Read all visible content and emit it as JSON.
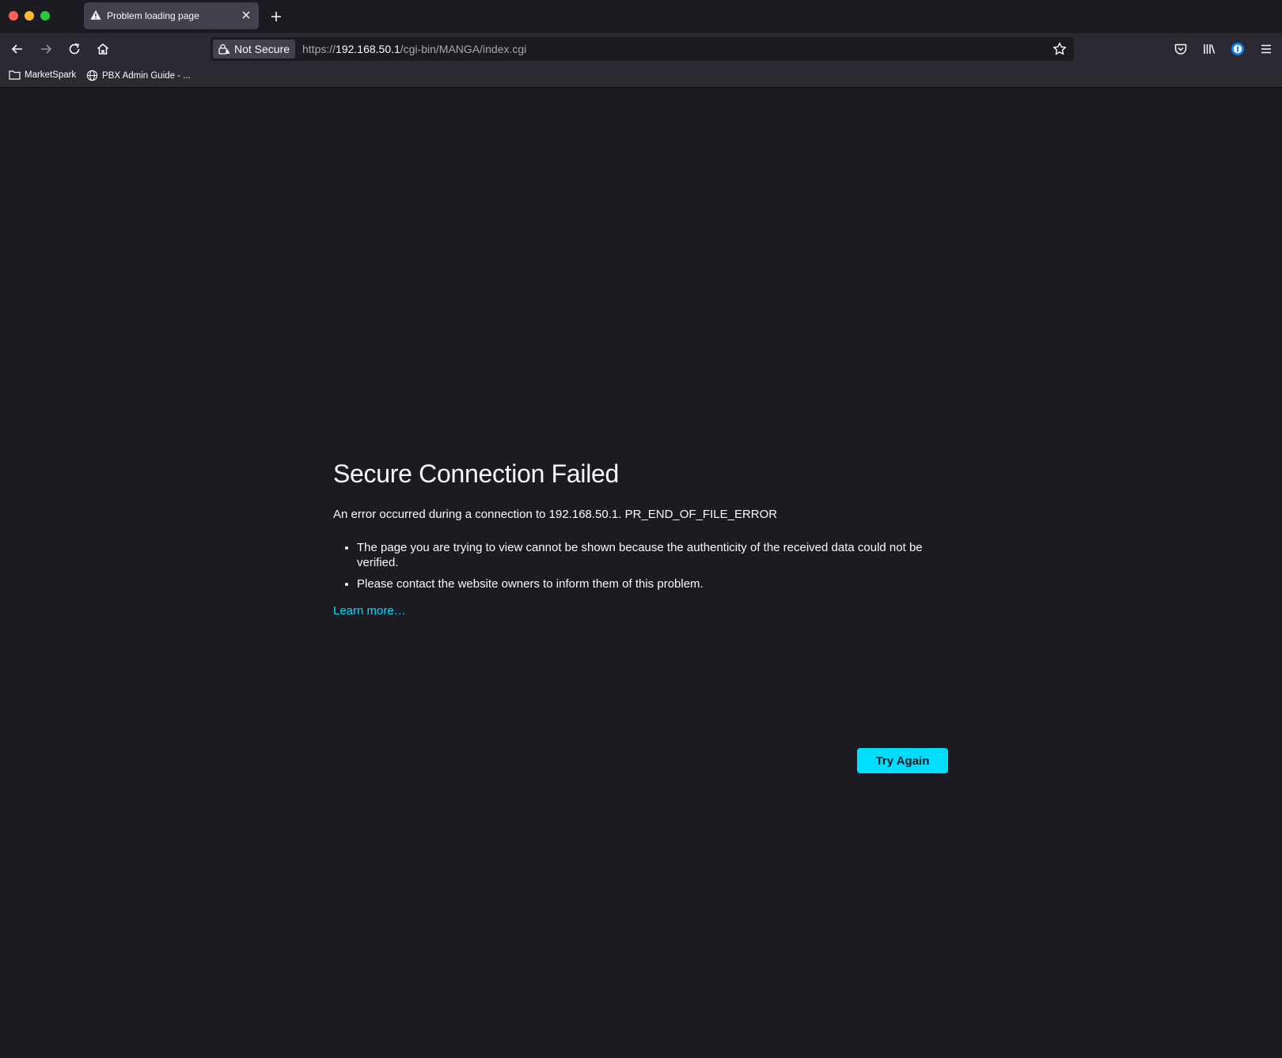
{
  "tab": {
    "title": "Problem loading page"
  },
  "url": {
    "security_label": "Not Secure",
    "scheme": "https://",
    "host": "192.168.50.1",
    "path": "/cgi-bin/MANGA/index.cgi"
  },
  "bookmarks": [
    {
      "label": "MarketSpark",
      "icon": "folder-icon"
    },
    {
      "label": "PBX Admin Guide - ...",
      "icon": "globe-icon"
    }
  ],
  "error": {
    "title": "Secure Connection Failed",
    "message": "An error occurred during a connection to 192.168.50.1. PR_END_OF_FILE_ERROR",
    "bullets": [
      "The page you are trying to view cannot be shown because the authenticity of the received data could not be verified.",
      "Please contact the website owners to inform them of this problem."
    ],
    "learn_more": "Learn more…",
    "try_again": "Try Again"
  },
  "colors": {
    "background": "#1c1b22",
    "toolbar": "#2b2a33",
    "accent": "#00ddff"
  }
}
